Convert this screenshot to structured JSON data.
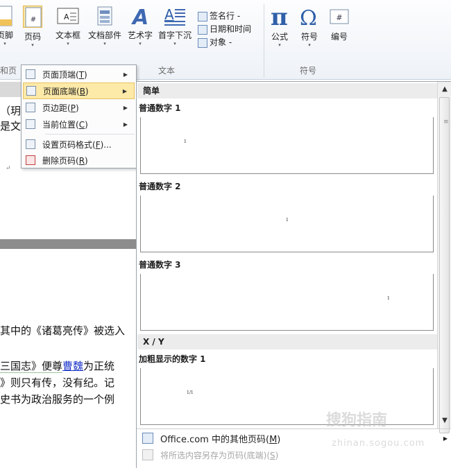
{
  "ribbon": {
    "buttons": {
      "footer": "页脚",
      "page_number": "页码",
      "text_box": "文本框",
      "quick_parts": "文档部件",
      "wordart": "艺术字",
      "drop_cap": "首字下沉",
      "equation": "公式",
      "symbol": "符号",
      "number": "编号"
    },
    "small": {
      "signature_line": "签名行 -",
      "date_time": "日期和时间",
      "object": "对象 -"
    },
    "groups": {
      "header_footer": "和页",
      "text": "文本",
      "symbols": "符号"
    }
  },
  "submenu": {
    "items": [
      {
        "label": "页面顶端(",
        "key": "T",
        "end": ")"
      },
      {
        "label": "页面底端(",
        "key": "B",
        "end": ")"
      },
      {
        "label": "页边距(",
        "key": "P",
        "end": ")"
      },
      {
        "label": "当前位置(",
        "key": "C",
        "end": ")"
      },
      {
        "label": "设置页码格式(",
        "key": "F",
        "end": ")..."
      },
      {
        "label": "删除页码(",
        "key": "R",
        "end": ")"
      }
    ]
  },
  "gallery": {
    "header_simple": "简单",
    "header_xy": "X / Y",
    "items": [
      {
        "label": "普通数字 1",
        "preview": "1"
      },
      {
        "label": "普通数字 2",
        "preview": "1"
      },
      {
        "label": "普通数字 3",
        "preview": "1"
      },
      {
        "label": "加粗显示的数字 1",
        "preview": "1/1"
      }
    ],
    "more": {
      "label": "Office.com 中的其他页码(",
      "key": "M",
      "end": ")"
    },
    "save": {
      "label": "将所选内容另存为页码(底端)(",
      "key": "S",
      "end": ")"
    }
  },
  "document": {
    "line1": "（玥",
    "line2": "是文",
    "line3": "其中的《诸葛亮传》被选入",
    "line4a": "三国志》便尊",
    "line4_link": "曹魏",
    "line4b": "为正统",
    "line5": "》则只有传，没有纪。记",
    "line6": "史书为政治服务的一个例",
    "para_mark": "↵"
  },
  "watermark": {
    "main": "搜狗指南",
    "sub": "zhinan.sogou.com"
  }
}
